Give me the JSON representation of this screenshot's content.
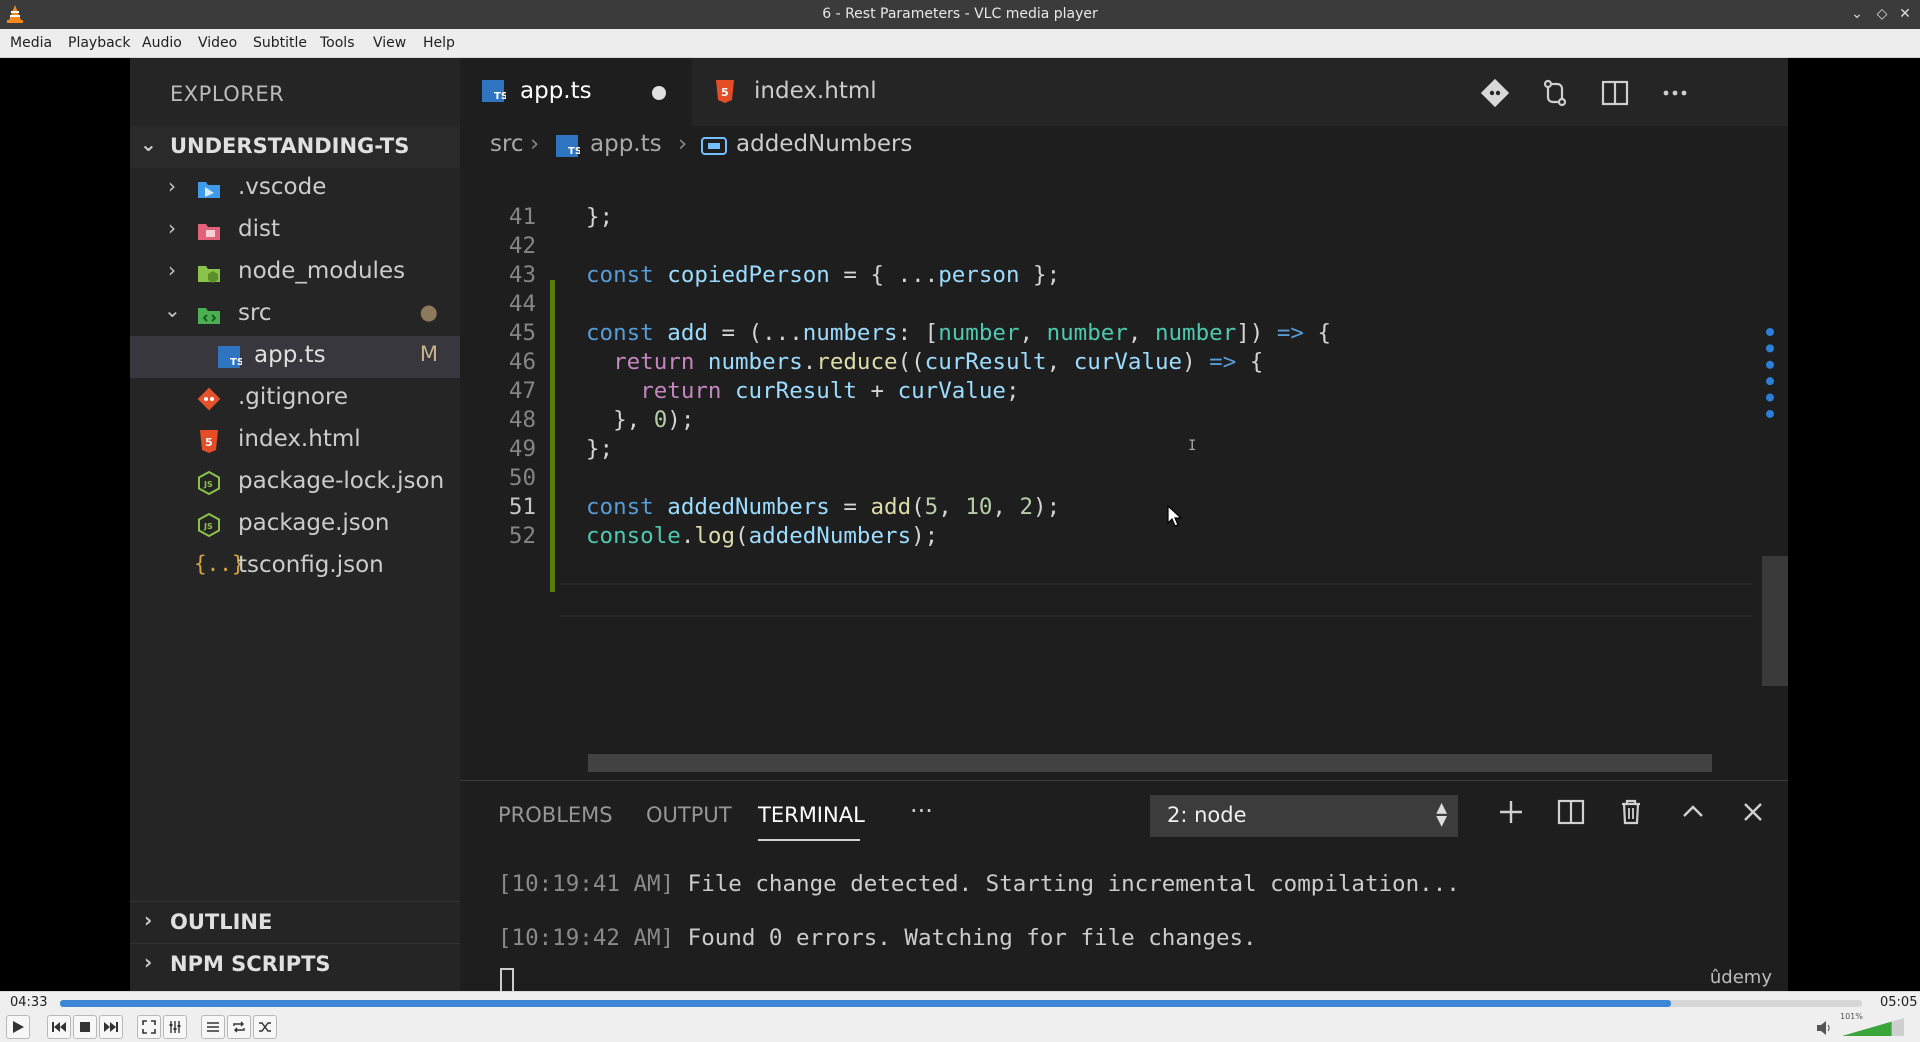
{
  "window": {
    "title": "6 - Rest Parameters - VLC media player",
    "controls": [
      "minimize-icon",
      "maximize-icon",
      "close-icon"
    ]
  },
  "menubar": {
    "items": [
      "Media",
      "Playback",
      "Audio",
      "Video",
      "Subtitle",
      "Tools",
      "View",
      "Help"
    ]
  },
  "player": {
    "time_elapsed": "04:33",
    "time_total": "05:05",
    "progress_fraction": 0.894,
    "volume_label": "101%",
    "volume_fraction": 0.8,
    "accent_color": "#3d86d6"
  },
  "vscode": {
    "sidebar": {
      "header": "EXPLORER",
      "project": "UNDERSTANDING-TS",
      "tree": [
        {
          "name": ".vscode",
          "kind": "folder",
          "icon": "vscode-folder-icon",
          "expanded": false
        },
        {
          "name": "dist",
          "kind": "folder",
          "icon": "dist-folder-icon",
          "expanded": false
        },
        {
          "name": "node_modules",
          "kind": "folder",
          "icon": "node-folder-icon",
          "expanded": false
        },
        {
          "name": "src",
          "kind": "folder",
          "icon": "src-folder-icon",
          "expanded": true,
          "status": "●"
        },
        {
          "name": "app.ts",
          "kind": "file",
          "icon": "typescript-file-icon",
          "status": "M",
          "selected": true
        },
        {
          "name": ".gitignore",
          "kind": "file",
          "icon": "git-file-icon"
        },
        {
          "name": "index.html",
          "kind": "file",
          "icon": "html-file-icon"
        },
        {
          "name": "package-lock.json",
          "kind": "file",
          "icon": "json-node-icon"
        },
        {
          "name": "package.json",
          "kind": "file",
          "icon": "json-node-icon"
        },
        {
          "name": "tsconfig.json",
          "kind": "file",
          "icon": "json-braces-icon"
        }
      ],
      "sections": [
        "OUTLINE",
        "NPM SCRIPTS"
      ]
    },
    "tabs": [
      {
        "label": "app.ts",
        "icon": "typescript-file-icon",
        "active": true,
        "dirty": true
      },
      {
        "label": "index.html",
        "icon": "html-file-icon",
        "active": false
      }
    ],
    "tab_actions": [
      "git-compare-icon",
      "open-changes-icon",
      "split-editor-icon",
      "more-actions-icon"
    ],
    "breadcrumbs": [
      "src",
      "app.ts",
      "addedNumbers"
    ],
    "editor": {
      "lines": [
        {
          "n": "41",
          "code": "};"
        },
        {
          "n": "42",
          "code": ""
        },
        {
          "n": "43",
          "code": "const copiedPerson = { ...person };"
        },
        {
          "n": "44",
          "code": ""
        },
        {
          "n": "45",
          "code": "const add = (...numbers: [number, number, number]) => {"
        },
        {
          "n": "46",
          "code": "  return numbers.reduce((curResult, curValue) => {"
        },
        {
          "n": "47",
          "code": "    return curResult + curValue;"
        },
        {
          "n": "48",
          "code": "  }, 0);"
        },
        {
          "n": "49",
          "code": "};"
        },
        {
          "n": "50",
          "code": ""
        },
        {
          "n": "51",
          "code": "const addedNumbers = add(5, 10, 2);"
        },
        {
          "n": "52",
          "code": "console.log(addedNumbers);"
        }
      ],
      "current_line": "51"
    },
    "panel": {
      "tabs": [
        "PROBLEMS",
        "OUTPUT",
        "TERMINAL"
      ],
      "active_tab": "TERMINAL",
      "more": "···",
      "terminal_select": "2: node",
      "actions": [
        "new-terminal-icon",
        "split-terminal-icon",
        "kill-terminal-icon",
        "maximize-panel-icon",
        "close-panel-icon"
      ],
      "terminal": [
        {
          "ts": "[10:19:41 AM]",
          "msg": " File change detected. Starting incremental compilation..."
        },
        {
          "ts": "[10:19:42 AM]",
          "msg": " Found 0 errors. Watching for file changes."
        }
      ],
      "watermark": "ûdemy"
    }
  }
}
